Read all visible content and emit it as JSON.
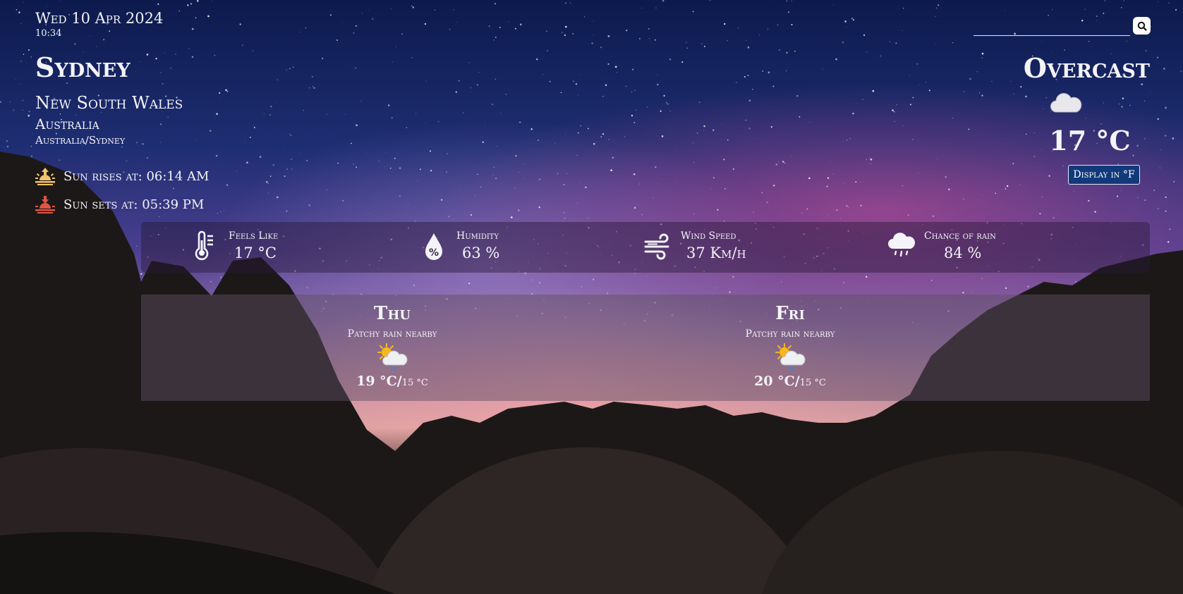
{
  "header": {
    "date": "Wed 10 Apr 2024",
    "time": "10:34"
  },
  "location": {
    "city": "Sydney",
    "region": "New South Wales",
    "country": "Australia",
    "timezone": "Australia/Sydney"
  },
  "sun": {
    "sunrise": "Sun rises at: 06:14 AM",
    "sunset": "Sun sets at: 05:39 PM"
  },
  "search": {
    "placeholder": "",
    "value": ""
  },
  "current": {
    "condition": "Overcast",
    "icon": "cloud-icon",
    "temperature": "17 °C",
    "unit_toggle_label": "Display in °F"
  },
  "stats": [
    {
      "label": "Feels Like",
      "value": "17 °C",
      "icon": "thermometer-icon"
    },
    {
      "label": "Humidity",
      "value": "63 %",
      "icon": "humidity-drop-icon"
    },
    {
      "label": "Wind Speed",
      "value": "37 Km/h",
      "icon": "wind-icon"
    },
    {
      "label": "Chance of rain",
      "value": "84 %",
      "icon": "rain-cloud-icon"
    }
  ],
  "forecast": [
    {
      "day": "Thu",
      "condition": "Patchy rain nearby",
      "icon": "sun-cloud-rain-icon",
      "high": "19 °C/",
      "low": "15 °C"
    },
    {
      "day": "Fri",
      "condition": "Patchy rain nearby",
      "icon": "sun-cloud-rain-icon",
      "high": "20 °C/",
      "low": "15 °C"
    }
  ],
  "colors": {
    "sunrise_icon": "#f2c56b",
    "sunset_icon": "#e0553f",
    "unit_button_bg": "#123a7a"
  }
}
